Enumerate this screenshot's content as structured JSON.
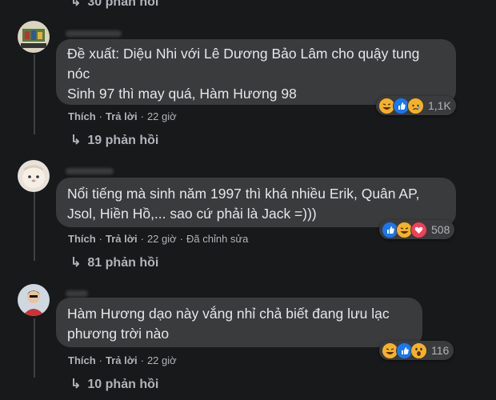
{
  "top_partial": {
    "text": "30 phản hồi"
  },
  "comments": [
    {
      "lines": [
        "Đề xuất: Diệu Nhi với Lê Dương Bảo Lâm cho quậy tung",
        "nóc",
        "Sinh 97 thì may quá, Hàm Hương 98"
      ],
      "like_label": "Thích",
      "reply_label": "Trả lời",
      "time": "22 giờ",
      "edited": "",
      "reaction_icons": [
        "haha-icon",
        "like-icon",
        "sad-icon"
      ],
      "reaction_count": "1,1K",
      "replies": "19 phản hồi"
    },
    {
      "lines": [
        "Nổi tiếng mà sinh năm 1997 thì khá nhiều Erik, Quân AP,",
        "Jsol, Hiền Hồ,... sao cứ phải là Jack =)))"
      ],
      "like_label": "Thích",
      "reply_label": "Trả lời",
      "time": "22 giờ",
      "edited": "Đã chỉnh sửa",
      "reaction_icons": [
        "like-icon",
        "haha-icon",
        "love-icon"
      ],
      "reaction_count": "508",
      "replies": "81 phản hồi"
    },
    {
      "lines": [
        "Hàm Hương dạo này vắng nhỉ chả biết đang lưu lạc",
        "phương trời nào"
      ],
      "like_label": "Thích",
      "reply_label": "Trả lời",
      "time": "22 giờ",
      "edited": "",
      "reaction_icons": [
        "haha-icon",
        "like-icon",
        "wow-icon"
      ],
      "reaction_count": "116",
      "replies": "10 phản hồi"
    }
  ],
  "colors": {
    "background": "#18191a",
    "bubble": "#3a3b3c",
    "text": "#e4e6eb",
    "muted": "#b0b3b8",
    "like_blue": "#1877f2",
    "reaction_yellow": "#f7b125"
  }
}
